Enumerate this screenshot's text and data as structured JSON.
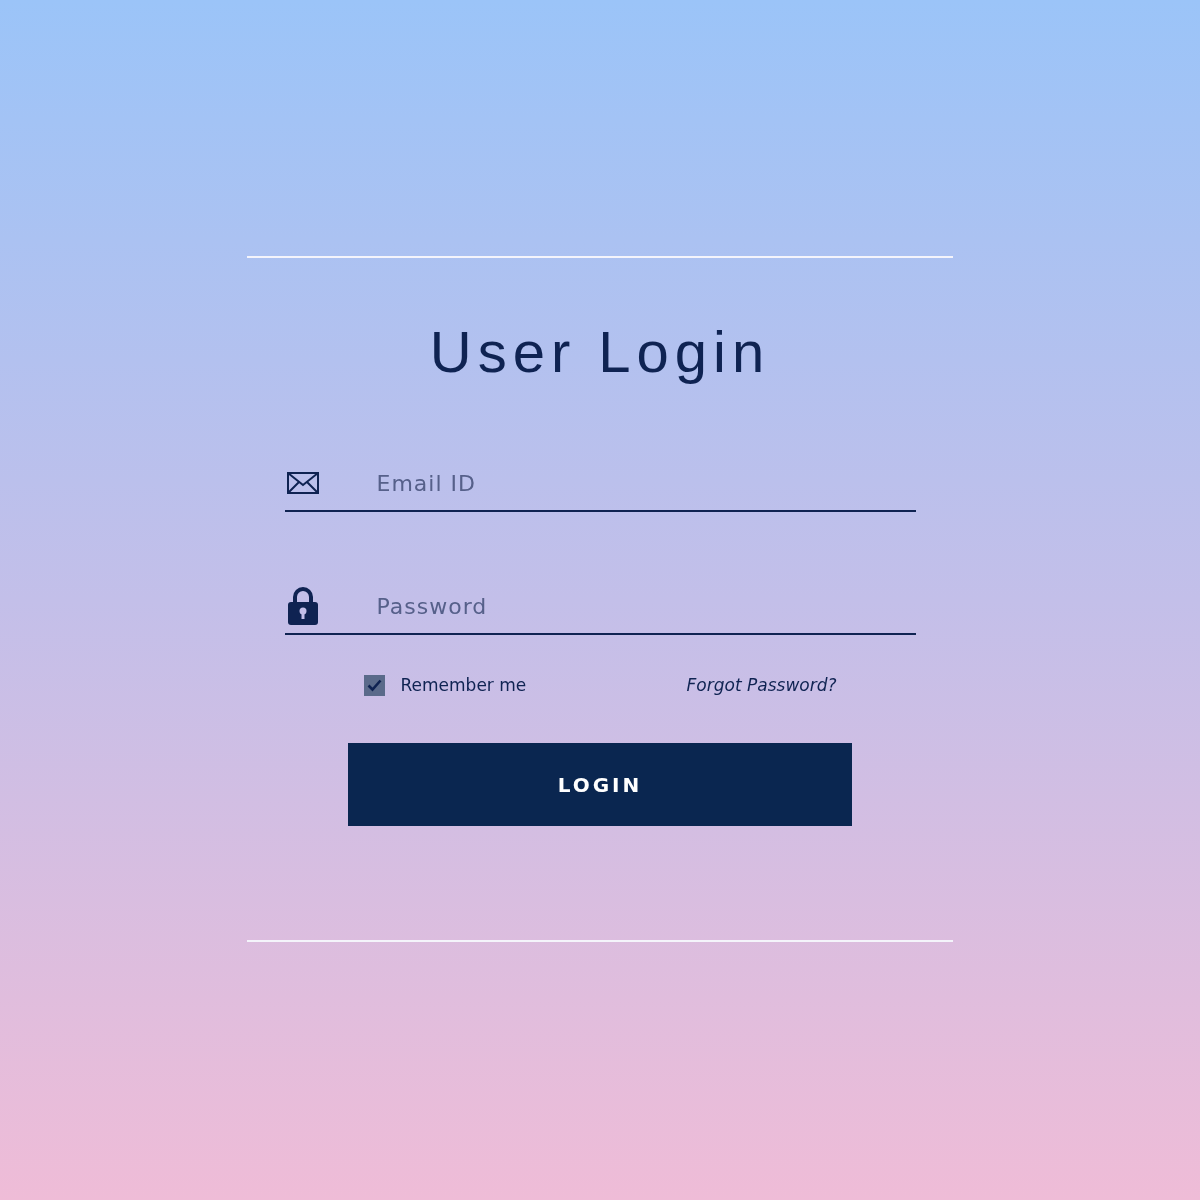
{
  "title": "User Login",
  "fields": [
    {
      "kind": "email",
      "placeholder": "Email ID"
    },
    {
      "kind": "password",
      "placeholder": "Password"
    }
  ],
  "remember": {
    "label": "Remember me",
    "checked": true
  },
  "forgot_link": "Forgot Password?",
  "login_button": "LOGIN"
}
